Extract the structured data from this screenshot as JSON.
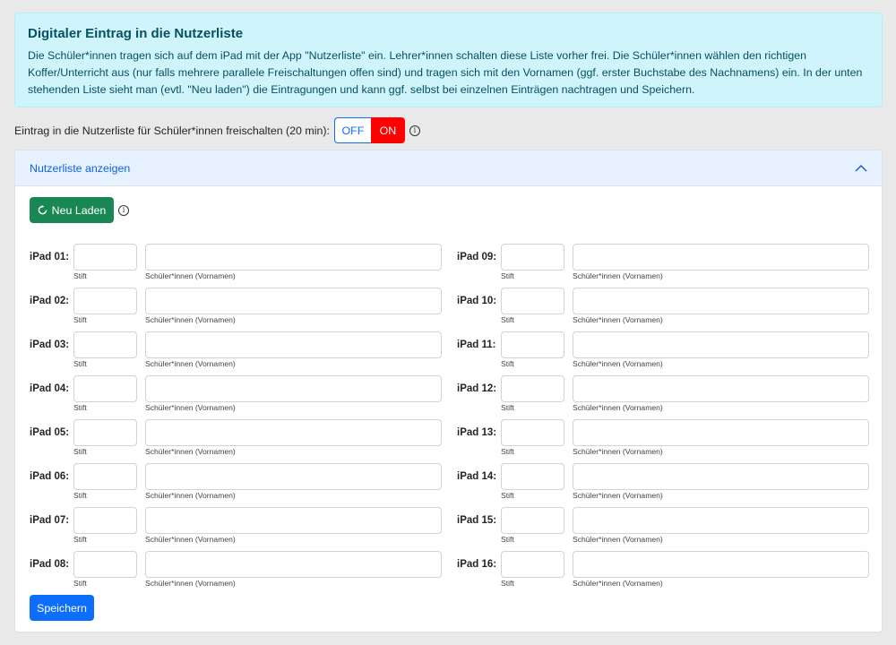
{
  "info": {
    "title": "Digitaler Eintrag in die Nutzerliste",
    "text": "Die Schüler*innen tragen sich auf dem iPad mit der App \"Nutzerliste\" ein. Lehrer*innen schalten diese Liste vorher frei. Die Schüler*innen wählen den richtigen Koffer/Unterricht aus (nur falls mehrere parallele Freischaltungen offen sind) und tragen sich mit den Vornamen (ggf. erster Buchstabe des Nachnamens) ein. In der unten stehenden Liste sieht man (evtl. \"Neu laden\") die Eintragungen und kann ggf. selbst bei einzelnen Einträgen nachtragen und Speichern."
  },
  "toggle": {
    "label": "Eintrag in die Nutzerliste für Schüler*innen freischalten (20 min):",
    "off_label": "OFF",
    "on_label": "ON",
    "state": "ON"
  },
  "accordion": {
    "header": "Nutzerliste anzeigen",
    "expanded": true
  },
  "reload": {
    "label": "Neu Laden"
  },
  "help": {
    "stift": "Stift",
    "names": "Schüler*innen (Vornamen)"
  },
  "ipads_left": [
    {
      "label": "iPad 01:",
      "stift": "",
      "names": ""
    },
    {
      "label": "iPad 02:",
      "stift": "",
      "names": ""
    },
    {
      "label": "iPad 03:",
      "stift": "",
      "names": ""
    },
    {
      "label": "iPad 04:",
      "stift": "",
      "names": ""
    },
    {
      "label": "iPad 05:",
      "stift": "",
      "names": ""
    },
    {
      "label": "iPad 06:",
      "stift": "",
      "names": ""
    },
    {
      "label": "iPad 07:",
      "stift": "",
      "names": ""
    },
    {
      "label": "iPad 08:",
      "stift": "",
      "names": ""
    }
  ],
  "ipads_right": [
    {
      "label": "iPad 09:",
      "stift": "",
      "names": ""
    },
    {
      "label": "iPad 10:",
      "stift": "",
      "names": ""
    },
    {
      "label": "iPad 11:",
      "stift": "",
      "names": ""
    },
    {
      "label": "iPad 12:",
      "stift": "",
      "names": ""
    },
    {
      "label": "iPad 13:",
      "stift": "",
      "names": ""
    },
    {
      "label": "iPad 14:",
      "stift": "",
      "names": ""
    },
    {
      "label": "iPad 15:",
      "stift": "",
      "names": ""
    },
    {
      "label": "iPad 16:",
      "stift": "",
      "names": ""
    }
  ],
  "save": {
    "label": "Speichern"
  },
  "colors": {
    "info_bg": "#cff4fc",
    "info_text": "#055160",
    "on_red": "#ff0000",
    "primary": "#0d6efd",
    "success": "#198754",
    "accordion_header_bg": "#e7f1ff"
  }
}
